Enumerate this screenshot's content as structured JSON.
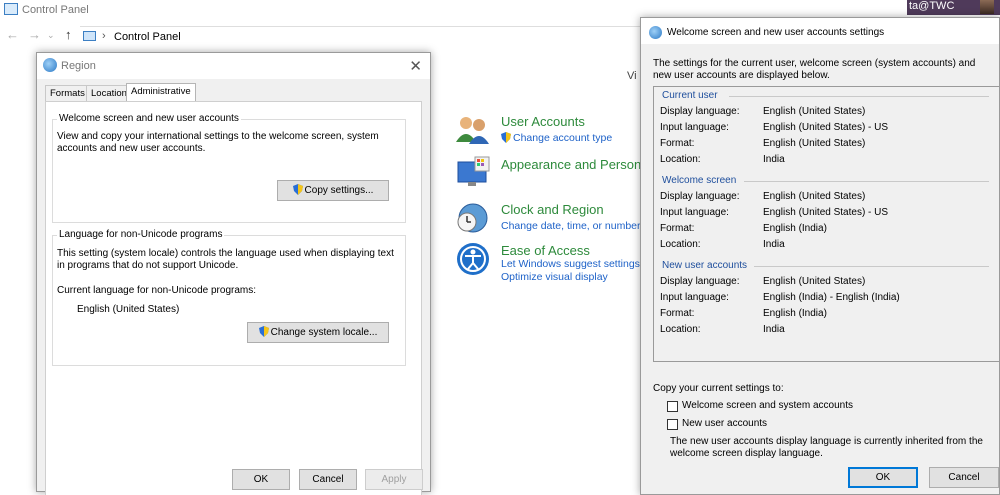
{
  "control_panel": {
    "title": "Control Panel",
    "breadcrumb": "Control Panel",
    "view_by": "Vi",
    "categories": [
      {
        "title": "User Accounts",
        "links": [
          "Change account type"
        ]
      },
      {
        "title": "Appearance and Persona",
        "links": []
      },
      {
        "title": "Clock and Region",
        "links": [
          "Change date, time, or number fo"
        ]
      },
      {
        "title": "Ease of Access",
        "links": [
          "Let Windows suggest settings",
          "Optimize visual display"
        ]
      }
    ]
  },
  "user_badge": "ta@TWC",
  "region": {
    "title": "Region",
    "tabs": [
      "Formats",
      "Location",
      "Administrative"
    ],
    "active_tab": "Administrative",
    "welcome_group": {
      "legend": "Welcome screen and new user accounts",
      "text": "View and copy your international settings to the welcome screen, system accounts and new user accounts.",
      "button": "Copy settings..."
    },
    "unicode_group": {
      "legend": "Language for non-Unicode programs",
      "text": "This setting (system locale) controls the language used when displaying text in programs that do not support Unicode.",
      "current_label": "Current language for non-Unicode programs:",
      "current_value": "English (United States)",
      "button": "Change system locale..."
    },
    "buttons": {
      "ok": "OK",
      "cancel": "Cancel",
      "apply": "Apply"
    }
  },
  "welcome": {
    "title": "Welcome screen and new user accounts settings",
    "description": "The settings for the current user, welcome screen (system accounts) and new user accounts are displayed below.",
    "sections": [
      {
        "name": "Current user",
        "rows": [
          [
            "Display language:",
            "English (United States)"
          ],
          [
            "Input language:",
            "English (United States) - US"
          ],
          [
            "Format:",
            "English (United States)"
          ],
          [
            "Location:",
            "India"
          ]
        ]
      },
      {
        "name": "Welcome screen",
        "rows": [
          [
            "Display language:",
            "English (United States)"
          ],
          [
            "Input language:",
            "English (United States) - US"
          ],
          [
            "Format:",
            "English (India)"
          ],
          [
            "Location:",
            "India"
          ]
        ]
      },
      {
        "name": "New user accounts",
        "rows": [
          [
            "Display language:",
            "English (United States)"
          ],
          [
            "Input language:",
            "English (India) - English (India)"
          ],
          [
            "Format:",
            "English (India)"
          ],
          [
            "Location:",
            "India"
          ]
        ]
      }
    ],
    "copy_label": "Copy your current settings to:",
    "checkboxes": [
      {
        "label": "Welcome screen and system accounts",
        "checked": false
      },
      {
        "label": "New user accounts",
        "checked": false
      }
    ],
    "note": "The new user accounts display language is currently inherited from the welcome screen display language.",
    "buttons": {
      "ok": "OK",
      "cancel": "Cancel"
    }
  }
}
